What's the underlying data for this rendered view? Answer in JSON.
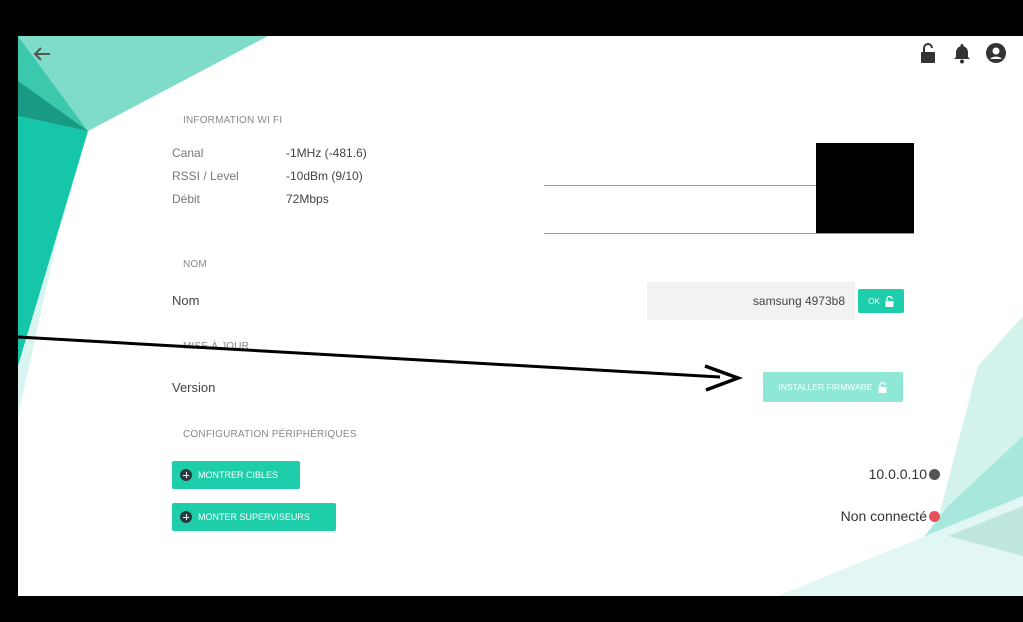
{
  "wifi": {
    "section_title": "INFORMATION WI FI",
    "rows": [
      {
        "label": "Canal",
        "value": "-1MHz (-481.6)"
      },
      {
        "label": "RSSI / Level",
        "value": "-10dBm (9/10)"
      },
      {
        "label": "Débit",
        "value": "72Mbps"
      }
    ]
  },
  "name": {
    "section_title": "NOM",
    "label": "Nom",
    "value": "samsung 4973b8",
    "ok_label": "OK"
  },
  "update": {
    "section_title": "MISE À JOUR",
    "label": "Version",
    "install_label": "INSTALLER FIRMWARE"
  },
  "devices": {
    "section_title": "CONFIGURATION PÉRIPHÉRIQUES",
    "show_targets_label": "MONTRER CIBLES",
    "show_supervisors_label": "MONTER SUPERVISEURS",
    "targets_status": "10.0.0.10",
    "supervisors_status": "Non connecté"
  },
  "colors": {
    "accent": "#1ecda9",
    "accent_disabled": "#8fe8d5",
    "status_error": "#e8505b",
    "status_neutral": "#555555"
  },
  "icons": {
    "back": "arrow-left-icon",
    "lock": "unlock-icon",
    "bell": "bell-icon",
    "user": "user-circle-icon"
  }
}
